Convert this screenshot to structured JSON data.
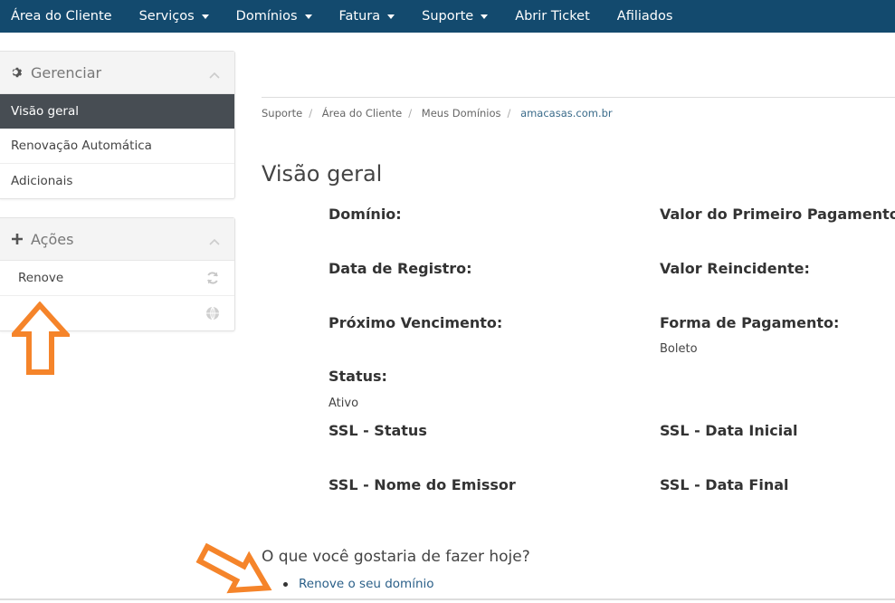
{
  "navbar": {
    "items": [
      {
        "label": "Área do Cliente",
        "dropdown": false
      },
      {
        "label": "Serviços",
        "dropdown": true
      },
      {
        "label": "Domínios",
        "dropdown": true
      },
      {
        "label": "Fatura",
        "dropdown": true
      },
      {
        "label": "Suporte",
        "dropdown": true
      },
      {
        "label": "Abrir Ticket",
        "dropdown": false
      },
      {
        "label": "Afiliados",
        "dropdown": false
      }
    ],
    "background": "#134a6e"
  },
  "sidebar": {
    "manage": {
      "title": "Gerenciar",
      "items": [
        {
          "label": "Visão geral",
          "active": true
        },
        {
          "label": "Renovação Automática",
          "active": false
        },
        {
          "label": "Adicionais",
          "active": false
        }
      ]
    },
    "actions": {
      "title": "Ações",
      "items": [
        {
          "label": "Renove",
          "icon": "refresh-icon"
        },
        {
          "label": "",
          "icon": "globe-icon"
        }
      ]
    }
  },
  "breadcrumb": [
    "Suporte",
    "Área do Cliente",
    "Meus Domínios",
    "amacasas.com.br"
  ],
  "main": {
    "title": "Visão geral",
    "fields": {
      "domain": {
        "label": "Domínio:",
        "value": ""
      },
      "first_payment": {
        "label": "Valor do Primeiro Pagamento:",
        "value": ""
      },
      "registration_date": {
        "label": "Data de Registro:",
        "value": ""
      },
      "recurring_amount": {
        "label": "Valor Reincidente:",
        "value": ""
      },
      "next_due": {
        "label": "Próximo Vencimento:",
        "value": ""
      },
      "payment_method": {
        "label": "Forma de Pagamento:",
        "value": "Boleto"
      },
      "status": {
        "label": "Status:",
        "value": "Ativo"
      },
      "ssl_status": {
        "label": "SSL - Status",
        "value": ""
      },
      "ssl_start": {
        "label": "SSL - Data Inicial",
        "value": ""
      },
      "ssl_issuer": {
        "label": "SSL - Nome do Emissor",
        "value": ""
      },
      "ssl_end": {
        "label": "SSL - Data Final",
        "value": ""
      }
    },
    "question": "O que você gostaria de fazer hoje?",
    "action_link": "Renove o seu domínio"
  },
  "colors": {
    "active_item": "#474d53",
    "link": "#2a5f88",
    "annotation_arrow": "#f5842a"
  }
}
